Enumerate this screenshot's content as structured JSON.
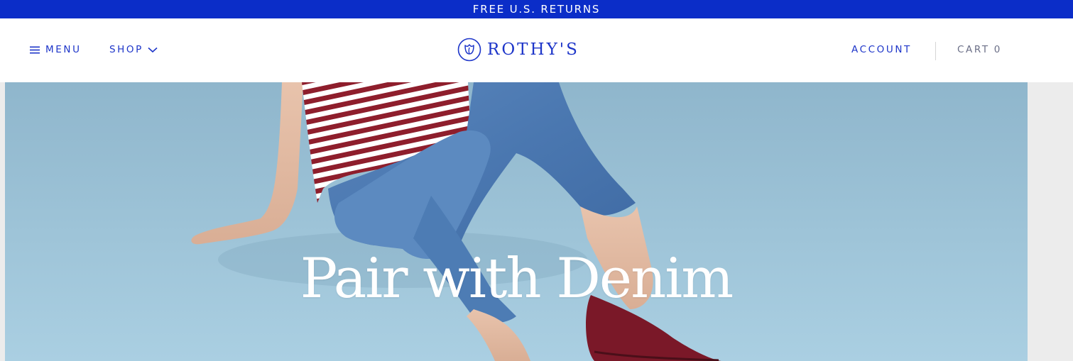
{
  "promo": {
    "text": "FREE U.S. RETURNS"
  },
  "header": {
    "menu_label": "MENU",
    "shop_label": "SHOP",
    "logo_text": "ROTHY'S",
    "account_label": "ACCOUNT",
    "cart_label": "CART",
    "cart_count": "0"
  },
  "hero": {
    "title": "Pair with Denim"
  },
  "colors": {
    "brand_blue": "#0b2dc8",
    "nav_blue": "#1d35c9",
    "hero_background": "#9ec4d8",
    "cart_gray": "#6b6f87"
  },
  "icons": {
    "menu": "hamburger-icon",
    "shop_dropdown": "chevron-down-icon",
    "logo": "tulip-logo-icon"
  }
}
